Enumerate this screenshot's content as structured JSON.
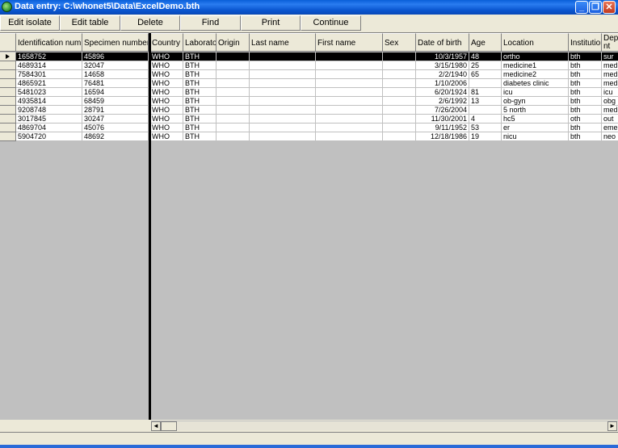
{
  "window": {
    "title": "Data entry:  C:\\whonet5\\Data\\ExcelDemo.bth",
    "minimize": "_",
    "maximize": "❐",
    "close": "✕"
  },
  "toolbar": {
    "edit_isolate": "Edit isolate",
    "edit_table": "Edit table",
    "delete": "Delete",
    "find": "Find",
    "print": "Print",
    "continue": "Continue"
  },
  "table": {
    "columns": [
      "Identification number",
      "Specimen number",
      "Country",
      "Laboratory",
      "Origin",
      "Last name",
      "First name",
      "Sex",
      "Date of birth",
      "Age",
      "Location",
      "Institution",
      "Depa nt"
    ],
    "rows": [
      [
        "1658752",
        "45896",
        "WHO",
        "BTH",
        "",
        "",
        "",
        "",
        "10/3/1957",
        "48",
        "ortho",
        "bth",
        "sur"
      ],
      [
        "4689314",
        "32047",
        "WHO",
        "BTH",
        "",
        "",
        "",
        "",
        "3/15/1980",
        "25",
        "medicine1",
        "bth",
        "med"
      ],
      [
        "7584301",
        "14658",
        "WHO",
        "BTH",
        "",
        "",
        "",
        "",
        "2/2/1940",
        "65",
        "medicine2",
        "bth",
        "med"
      ],
      [
        "4865921",
        "76481",
        "WHO",
        "BTH",
        "",
        "",
        "",
        "",
        "1/10/2006",
        "",
        "diabetes clinic",
        "bth",
        "med"
      ],
      [
        "5481023",
        "16594",
        "WHO",
        "BTH",
        "",
        "",
        "",
        "",
        "6/20/1924",
        "81",
        "icu",
        "bth",
        "icu"
      ],
      [
        "4935814",
        "68459",
        "WHO",
        "BTH",
        "",
        "",
        "",
        "",
        "2/6/1992",
        "13",
        "ob-gyn",
        "bth",
        "obg"
      ],
      [
        "9208748",
        "28791",
        "WHO",
        "BTH",
        "",
        "",
        "",
        "",
        "7/26/2004",
        "",
        "5 north",
        "bth",
        "med"
      ],
      [
        "3017845",
        "30247",
        "WHO",
        "BTH",
        "",
        "",
        "",
        "",
        "11/30/2001",
        "4",
        "hc5",
        "oth",
        "out"
      ],
      [
        "4869704",
        "45076",
        "WHO",
        "BTH",
        "",
        "",
        "",
        "",
        "9/11/1952",
        "53",
        "er",
        "bth",
        "eme"
      ],
      [
        "5904720",
        "48692",
        "WHO",
        "BTH",
        "",
        "",
        "",
        "",
        "12/18/1986",
        "19",
        "nicu",
        "bth",
        "neo"
      ]
    ],
    "selected_row": 0
  },
  "scrollbar": {
    "left_arrow": "◄",
    "right_arrow": "►"
  }
}
